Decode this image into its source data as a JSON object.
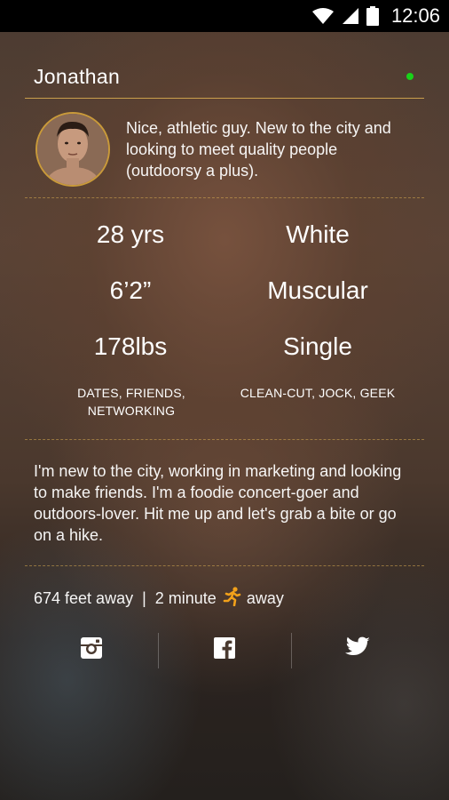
{
  "status_bar": {
    "time": "12:06",
    "icons": [
      "wifi-icon",
      "signal-icon",
      "battery-icon"
    ]
  },
  "profile": {
    "name": "Jonathan",
    "online": true,
    "blurb": "Nice, athletic guy.  New to the city and looking to meet quality people (outdoorsy a plus).",
    "stats": {
      "age": "28 yrs",
      "ethnicity": "White",
      "height": "6’2”",
      "body_type": "Muscular",
      "weight": "178lbs",
      "relationship": "Single"
    },
    "looking_for": "DATES, FRIENDS, NETWORKING",
    "tribes": "CLEAN-CUT, JOCK, GEEK",
    "bio": "I'm new to the city, working in marketing and looking to make friends.  I'm a foodie concert-goer and outdoors-lover.  Hit me up and let's grab a bite or go on a hike.",
    "distance": {
      "feet": "674 feet away",
      "separator": "|",
      "time_prefix": "2 minute",
      "time_suffix": "away"
    }
  },
  "social": [
    {
      "name": "instagram",
      "icon": "instagram-icon"
    },
    {
      "name": "facebook",
      "icon": "facebook-icon"
    },
    {
      "name": "twitter",
      "icon": "twitter-icon"
    }
  ],
  "colors": {
    "accent": "#d6aa50",
    "online": "#19d219",
    "runner": "#f2a11a",
    "status_bar": "#000000"
  }
}
